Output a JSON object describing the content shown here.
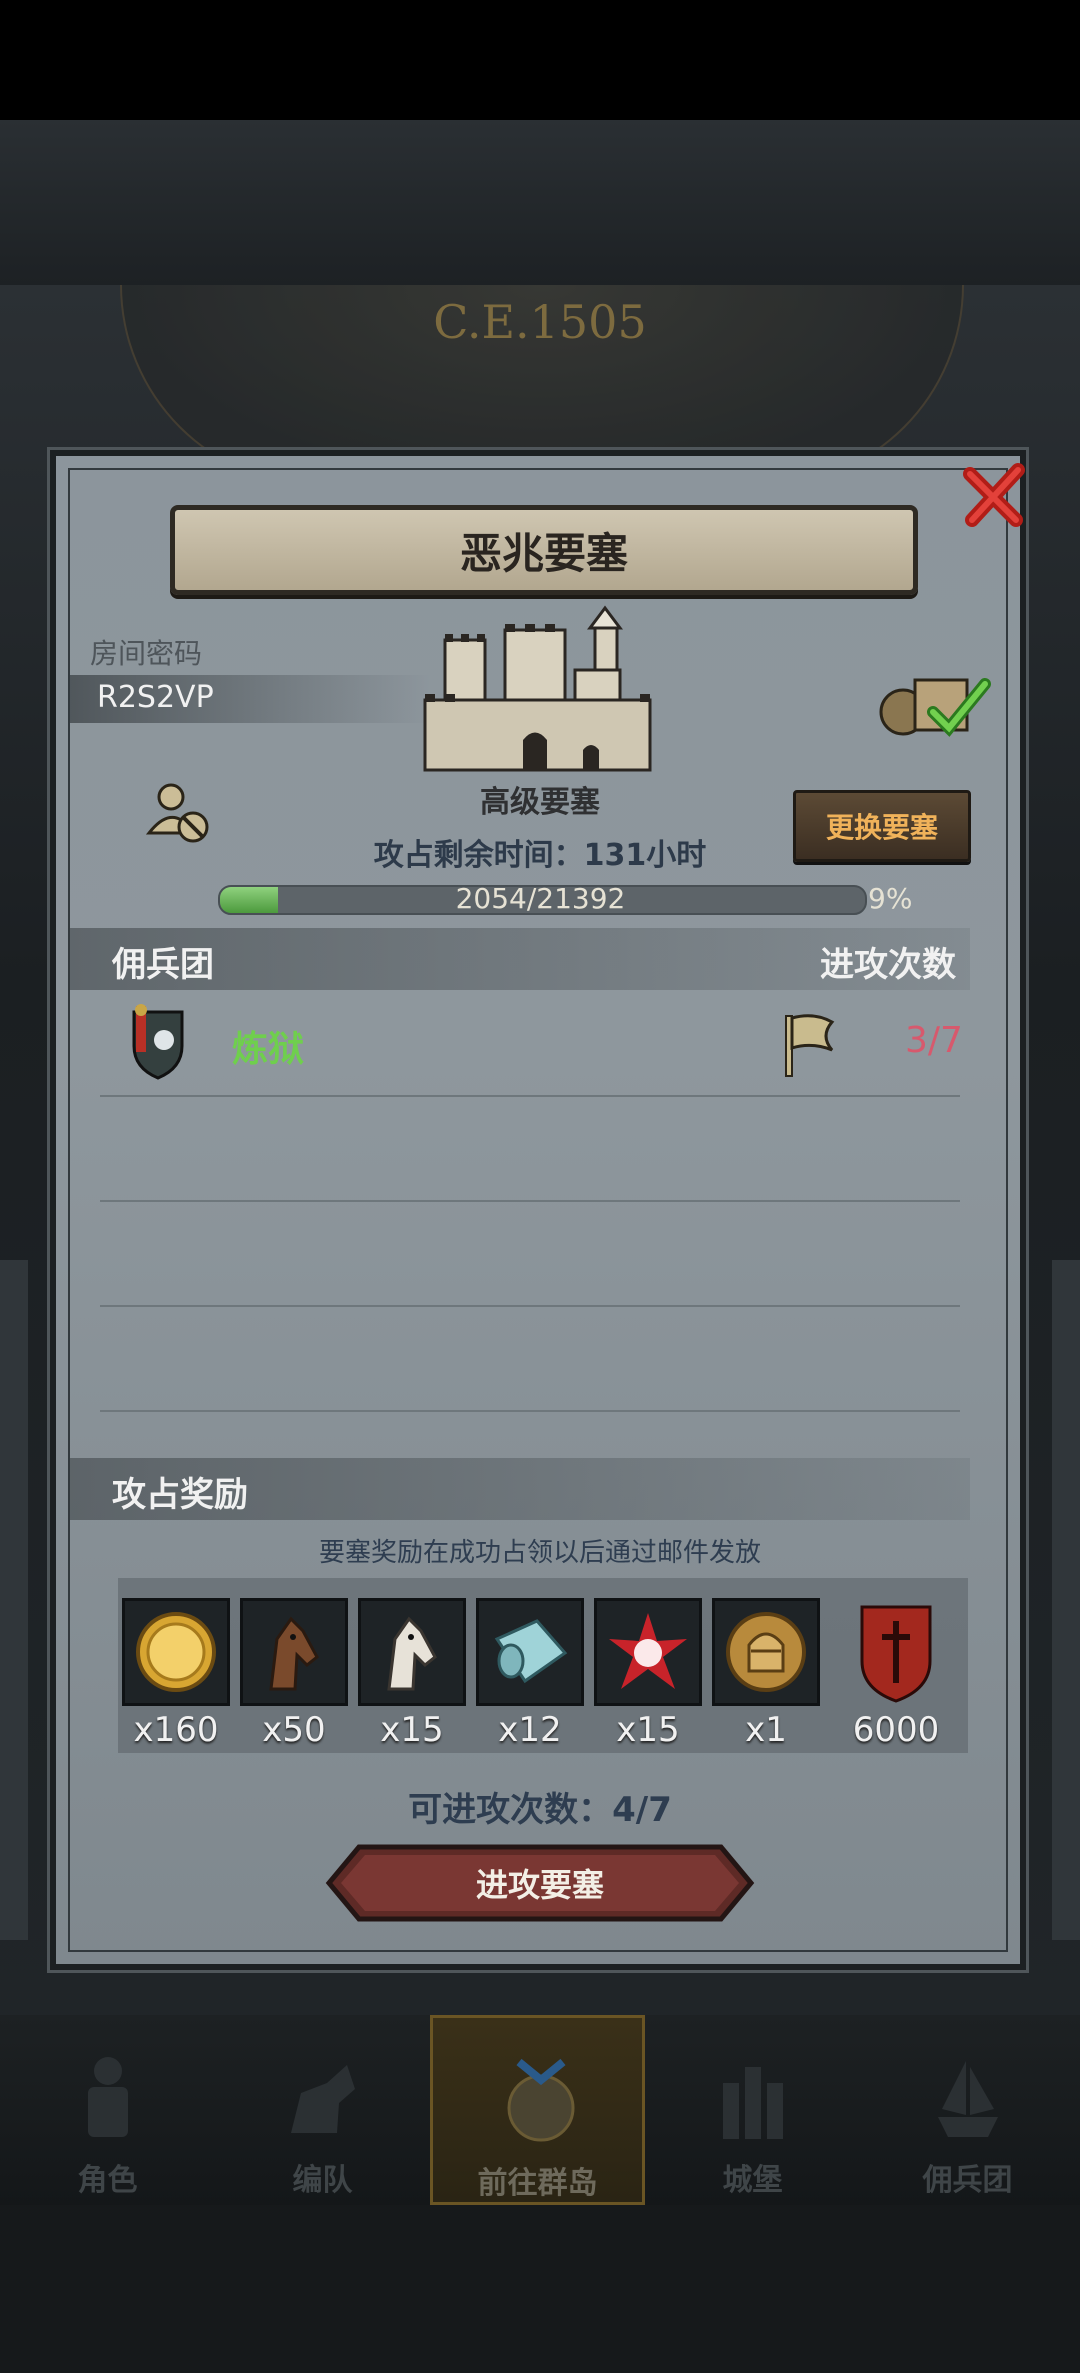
{
  "background": {
    "era_text": "C.E.1505"
  },
  "modal": {
    "title": "恶兆要塞",
    "room_label": "房间密码",
    "room_code": "R2S2VP",
    "fortress_type": "高级要塞",
    "change_button": "更换要塞",
    "time_remaining": "攻占剩余时间：131小时",
    "progress": {
      "current": 2054,
      "total": 21392,
      "text": "2054/21392",
      "percent_text": "9%",
      "fraction": 0.09
    },
    "mercenary_section": {
      "title": "佣兵团",
      "count_header": "进攻次数"
    },
    "mercenaries": [
      {
        "name": "炼狱",
        "attacks": "3/7"
      }
    ],
    "reward_section": {
      "title": "攻占奖励",
      "note": "要塞奖励在成功占领以后通过邮件发放",
      "items": [
        {
          "icon": "gold-coin-icon",
          "qty": "x160"
        },
        {
          "icon": "brown-horse-icon",
          "qty": "x50"
        },
        {
          "icon": "white-horse-icon",
          "qty": "x15"
        },
        {
          "icon": "cloth-scroll-icon",
          "qty": "x12"
        },
        {
          "icon": "red-star-burst-icon",
          "qty": "x15"
        },
        {
          "icon": "knight-helmet-coin-icon",
          "qty": "x1"
        },
        {
          "icon": "red-shield-emblem-icon",
          "qty": "6000"
        }
      ]
    },
    "can_attack": "可进攻次数：4/7",
    "attack_button": "进攻要塞"
  },
  "nav": {
    "items": [
      {
        "label": "角色",
        "icon": "knight-icon"
      },
      {
        "label": "编队",
        "icon": "cavalry-icon"
      },
      {
        "label": "前往群岛",
        "icon": "compass-icon",
        "active": true
      },
      {
        "label": "城堡",
        "icon": "castle-icon"
      },
      {
        "label": "佣兵团",
        "icon": "ship-icon"
      }
    ]
  },
  "colors": {
    "green_text": "#6fcf4d",
    "red_count": "#d7596d",
    "orange_button_text": "#f0b25a"
  }
}
